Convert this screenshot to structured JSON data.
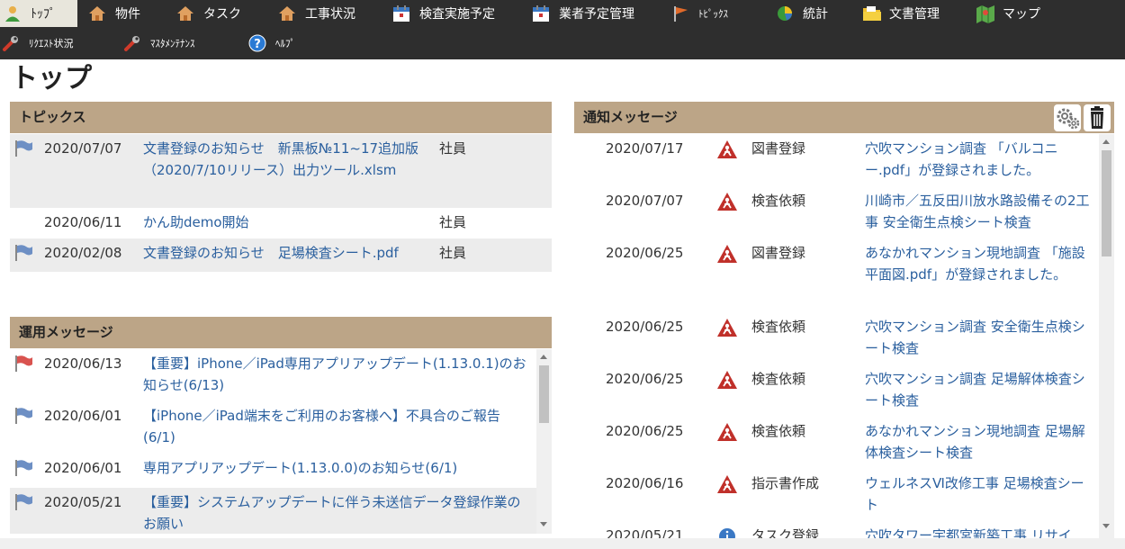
{
  "nav": {
    "row1": [
      {
        "label": "ﾄｯﾌﾟ",
        "icon": "person-icon",
        "active": true
      },
      {
        "label": "物件",
        "icon": "house-icon"
      },
      {
        "label": "タスク",
        "icon": "house-icon"
      },
      {
        "label": "工事状況",
        "icon": "house-icon"
      },
      {
        "label": "検査実施予定",
        "icon": "calendar-icon"
      },
      {
        "label": "業者予定管理",
        "icon": "calendar-icon"
      },
      {
        "label": "ﾄﾋﾟｯｸｽ",
        "icon": "flag-icon"
      },
      {
        "label": "統計",
        "icon": "pie-chart-icon"
      },
      {
        "label": "文書管理",
        "icon": "folder-icon"
      },
      {
        "label": "マップ",
        "icon": "map-icon"
      }
    ],
    "row2": [
      {
        "label": "ﾘｸｴｽﾄ状況",
        "icon": "wrench-icon"
      },
      {
        "label": "ﾏｽﾀﾒﾝﾃﾅﾝｽ",
        "icon": "wrench-icon"
      },
      {
        "label": "ﾍﾙﾌﾟ",
        "icon": "help-icon"
      }
    ]
  },
  "page_title": "トップ",
  "topics": {
    "title": "トピックス",
    "items": [
      {
        "date": "2020/07/07",
        "title": "文書登録のお知らせ　新黒板№11~17追加版（2020/7/10リリース）出力ツール.xlsm",
        "author": "社員",
        "flag": "blue"
      },
      {
        "date": "2020/06/11",
        "title": "かん助demo開始",
        "author": "社員",
        "flag": "none"
      },
      {
        "date": "2020/02/08",
        "title": "文書登録のお知らせ　足場検査シート.pdf",
        "author": "社員",
        "flag": "blue"
      }
    ]
  },
  "operations": {
    "title": "運用メッセージ",
    "items": [
      {
        "date": "2020/06/13",
        "title": "【重要】iPhone／iPad専用アプリアップデート(1.13.0.1)のお知らせ(6/13)",
        "flag": "red"
      },
      {
        "date": "2020/06/01",
        "title": "【iPhone／iPad端末をご利用のお客様へ】不具合のご報告(6/1)",
        "flag": "blue"
      },
      {
        "date": "2020/06/01",
        "title": "専用アプリアップデート(1.13.0.0)のお知らせ(6/1)",
        "flag": "blue"
      },
      {
        "date": "2020/05/21",
        "title": "【重要】システムアップデートに伴う未送信データ登録作業のお願い",
        "flag": "blue"
      }
    ]
  },
  "notices": {
    "title": "通知メッセージ",
    "items": [
      {
        "date": "2020/07/17",
        "category": "図書登録",
        "message": "穴吹マンション調査 「バルコニー.pdf」が登録されました。"
      },
      {
        "date": "2020/07/07",
        "category": "検査依頼",
        "message": "川崎市／五反田川放水路設備その2工事 安全衛生点検シート検査"
      },
      {
        "date": "2020/06/25",
        "category": "図書登録",
        "message": "あなかれマンション現地調査 「施設平面図.pdf」が登録されました。"
      },
      {
        "date": "2020/06/25",
        "category": "検査依頼",
        "message": "穴吹マンション調査 安全衛生点検シート検査"
      },
      {
        "date": "2020/06/25",
        "category": "検査依頼",
        "message": "穴吹マンション調査 足場解体検査シート検査"
      },
      {
        "date": "2020/06/25",
        "category": "検査依頼",
        "message": "あなかれマンション現地調査 足場解体検査シート検査"
      },
      {
        "date": "2020/06/16",
        "category": "指示書作成",
        "message": "ウェルネスⅥ改修工事 足場検査シート"
      }
    ],
    "partial_date": "2020/05/21",
    "partial_category": "タスク登録",
    "partial_message": "穴吹タワー宇都宮新築工事 リサイ"
  },
  "colors": {
    "nav_bg": "#2e2e2e",
    "panel_header": "#bca587",
    "link": "#2a5f9e",
    "row_shade": "#ececec",
    "flag_blue": "#6d8fc4",
    "flag_red": "#d9534f"
  }
}
